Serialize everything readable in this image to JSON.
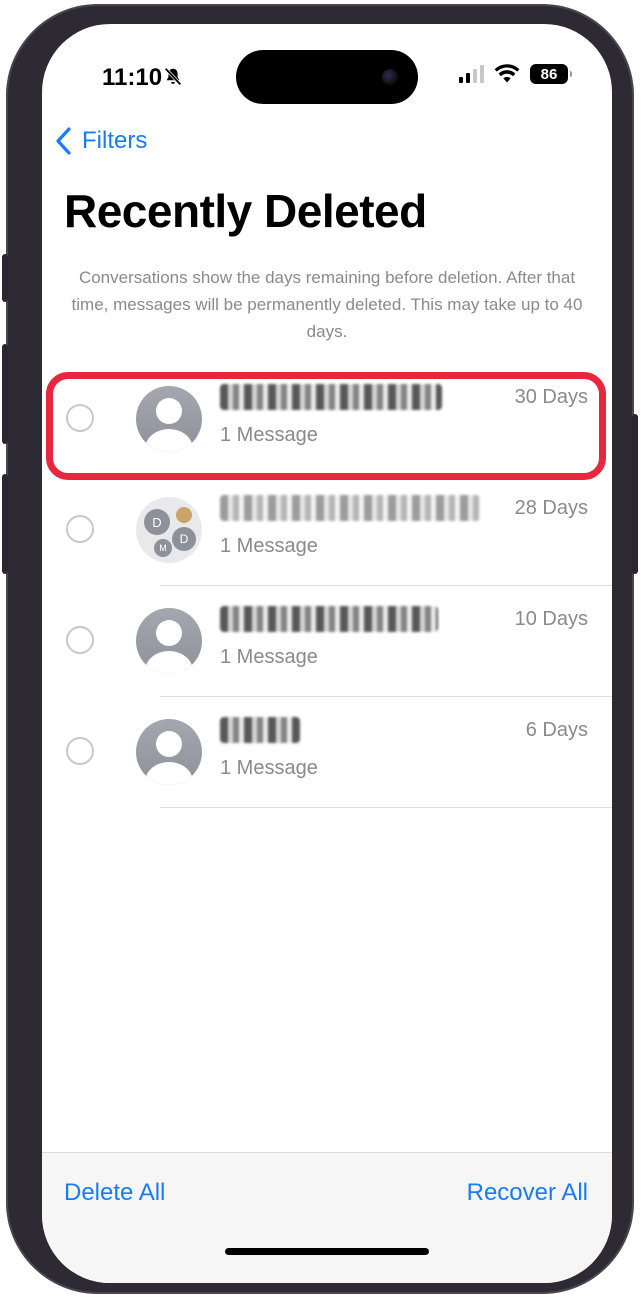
{
  "status_bar": {
    "time": "11:10",
    "battery": "86"
  },
  "nav": {
    "back_label": "Filters"
  },
  "page": {
    "title": "Recently Deleted",
    "subtitle": "Conversations show the days remaining before deletion. After that time, messages will be permanently deleted. This may take up to 40 days."
  },
  "conversations": [
    {
      "count": "1 Message",
      "days": "30 Days",
      "avatar": "person-icon",
      "highlighted": true
    },
    {
      "count": "1 Message",
      "days": "28 Days",
      "avatar": "group-avatar-icon"
    },
    {
      "count": "1 Message",
      "days": "10 Days",
      "avatar": "person-icon"
    },
    {
      "count": "1 Message",
      "days": "6 Days",
      "avatar": "person-icon"
    }
  ],
  "group_avatar": {
    "initials": [
      "D",
      "D",
      "M"
    ]
  },
  "toolbar": {
    "delete_all": "Delete All",
    "recover_all": "Recover All"
  },
  "colors": {
    "accent": "#1a7cf5",
    "highlight": "#e8263d",
    "secondary_text": "#8a8a8e"
  }
}
